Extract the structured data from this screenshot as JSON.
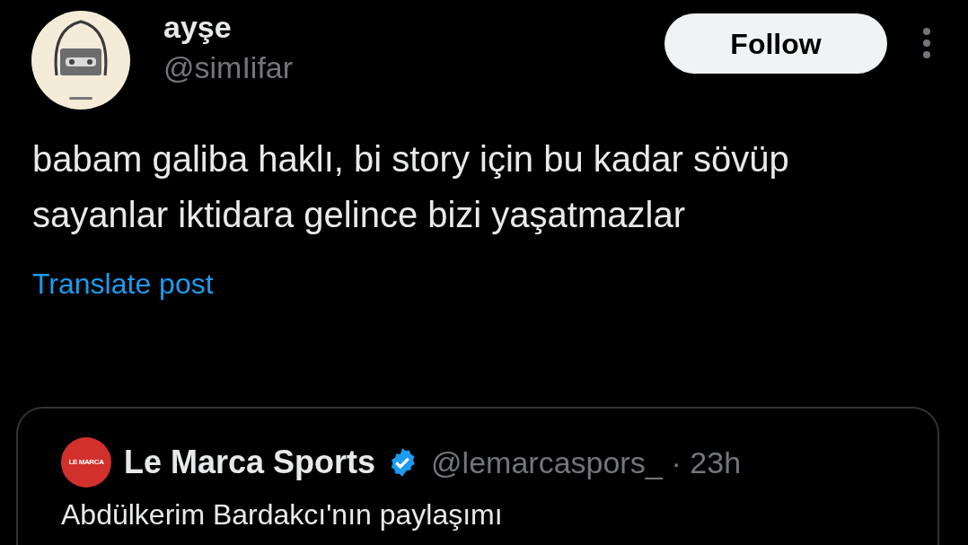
{
  "author": {
    "name": "ayşe",
    "handle": "@simIifar"
  },
  "follow_button": "Follow",
  "post_text": "babam galiba haklı, bi story için bu kadar sövüp sayanlar iktidara gelince bizi yaşatmazlar",
  "translate_link": "Translate post",
  "quoted_post": {
    "logo_text": "LE MARCA",
    "name": "Le Marca Sports",
    "verified": true,
    "handle": "@lemarcaspors_",
    "time": "· 23h",
    "text": "Abdülkerim Bardakcı'nın paylaşımı"
  }
}
